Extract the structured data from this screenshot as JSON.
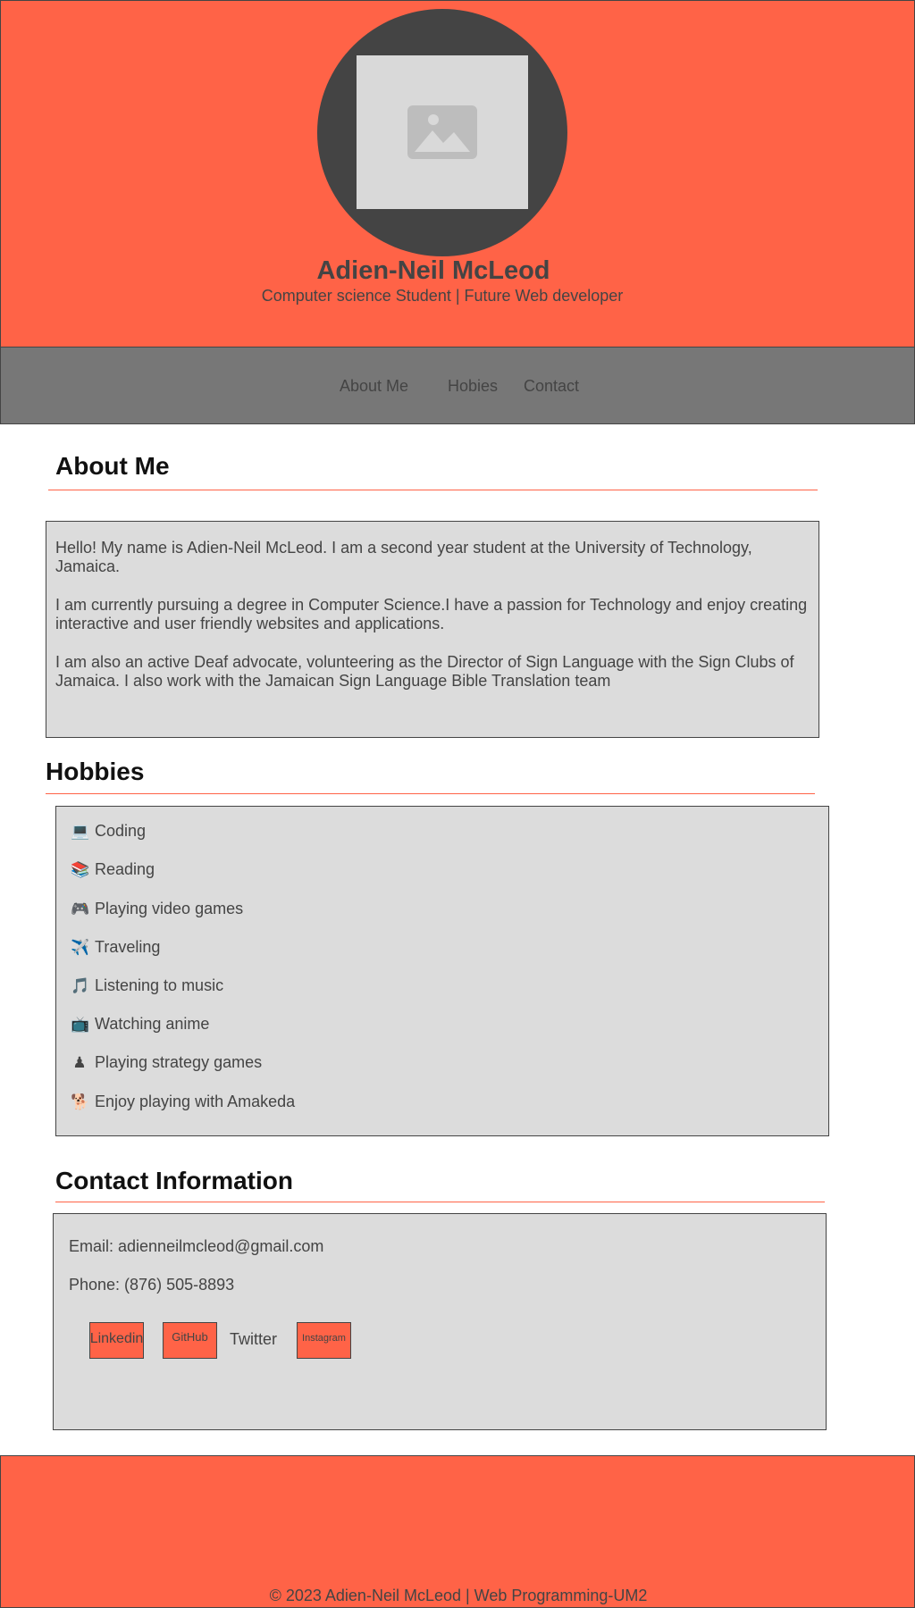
{
  "header": {
    "name": "Adien-Neil McLeod",
    "tagline": "Computer science Student | Future Web developer",
    "avatar_icon": "image-placeholder-icon"
  },
  "nav": {
    "items": [
      {
        "label": "About Me"
      },
      {
        "label": "Hobies"
      },
      {
        "label": "Contact"
      }
    ]
  },
  "about": {
    "heading": "About Me",
    "paragraphs": [
      "Hello! My name is Adien-Neil McLeod. I am a second year student at the University of Technology, Jamaica.",
      "I am currently pursuing a degree in Computer Science.I have a passion for Technology and enjoy creating interactive and user friendly websites and applications.",
      "I am also an active Deaf advocate, volunteering as the Director of Sign Language with the Sign Clubs of Jamaica. I also work with the Jamaican Sign Language Bible Translation team"
    ]
  },
  "hobbies": {
    "heading": "Hobbies",
    "items": [
      {
        "emoji": "💻",
        "icon": "computer-icon",
        "label": "Coding"
      },
      {
        "emoji": "📚",
        "icon": "books-icon",
        "label": "Reading"
      },
      {
        "emoji": "🎮",
        "icon": "gamepad-icon",
        "label": "Playing video games"
      },
      {
        "emoji": "✈️",
        "icon": "airplane-icon",
        "label": "Traveling"
      },
      {
        "emoji": "🎵",
        "icon": "music-note-icon",
        "label": "Listening to music"
      },
      {
        "emoji": "📺",
        "icon": "television-icon",
        "label": "Watching anime"
      },
      {
        "emoji": "♟",
        "icon": "chess-pawn-icon",
        "label": "Playing strategy games"
      },
      {
        "emoji": "🐕",
        "icon": "dog-icon",
        "label": "Enjoy playing with Amakeda"
      }
    ]
  },
  "contact": {
    "heading": "Contact Information",
    "email": "Email: adienneilmcleod@gmail.com",
    "phone": "Phone: (876) 505-8893",
    "links": {
      "linkedin": "Linkedin",
      "github": "GitHub",
      "twitter": "Twitter",
      "instagram": "Instagram"
    }
  },
  "footer": {
    "text": "© 2023 Adien-Neil McLeod | Web Programming-UM2"
  },
  "colors": {
    "accent": "#ff6347",
    "nav_bg": "#777777",
    "panel_bg": "#dcdcdc",
    "avatar_ring": "#444444"
  }
}
